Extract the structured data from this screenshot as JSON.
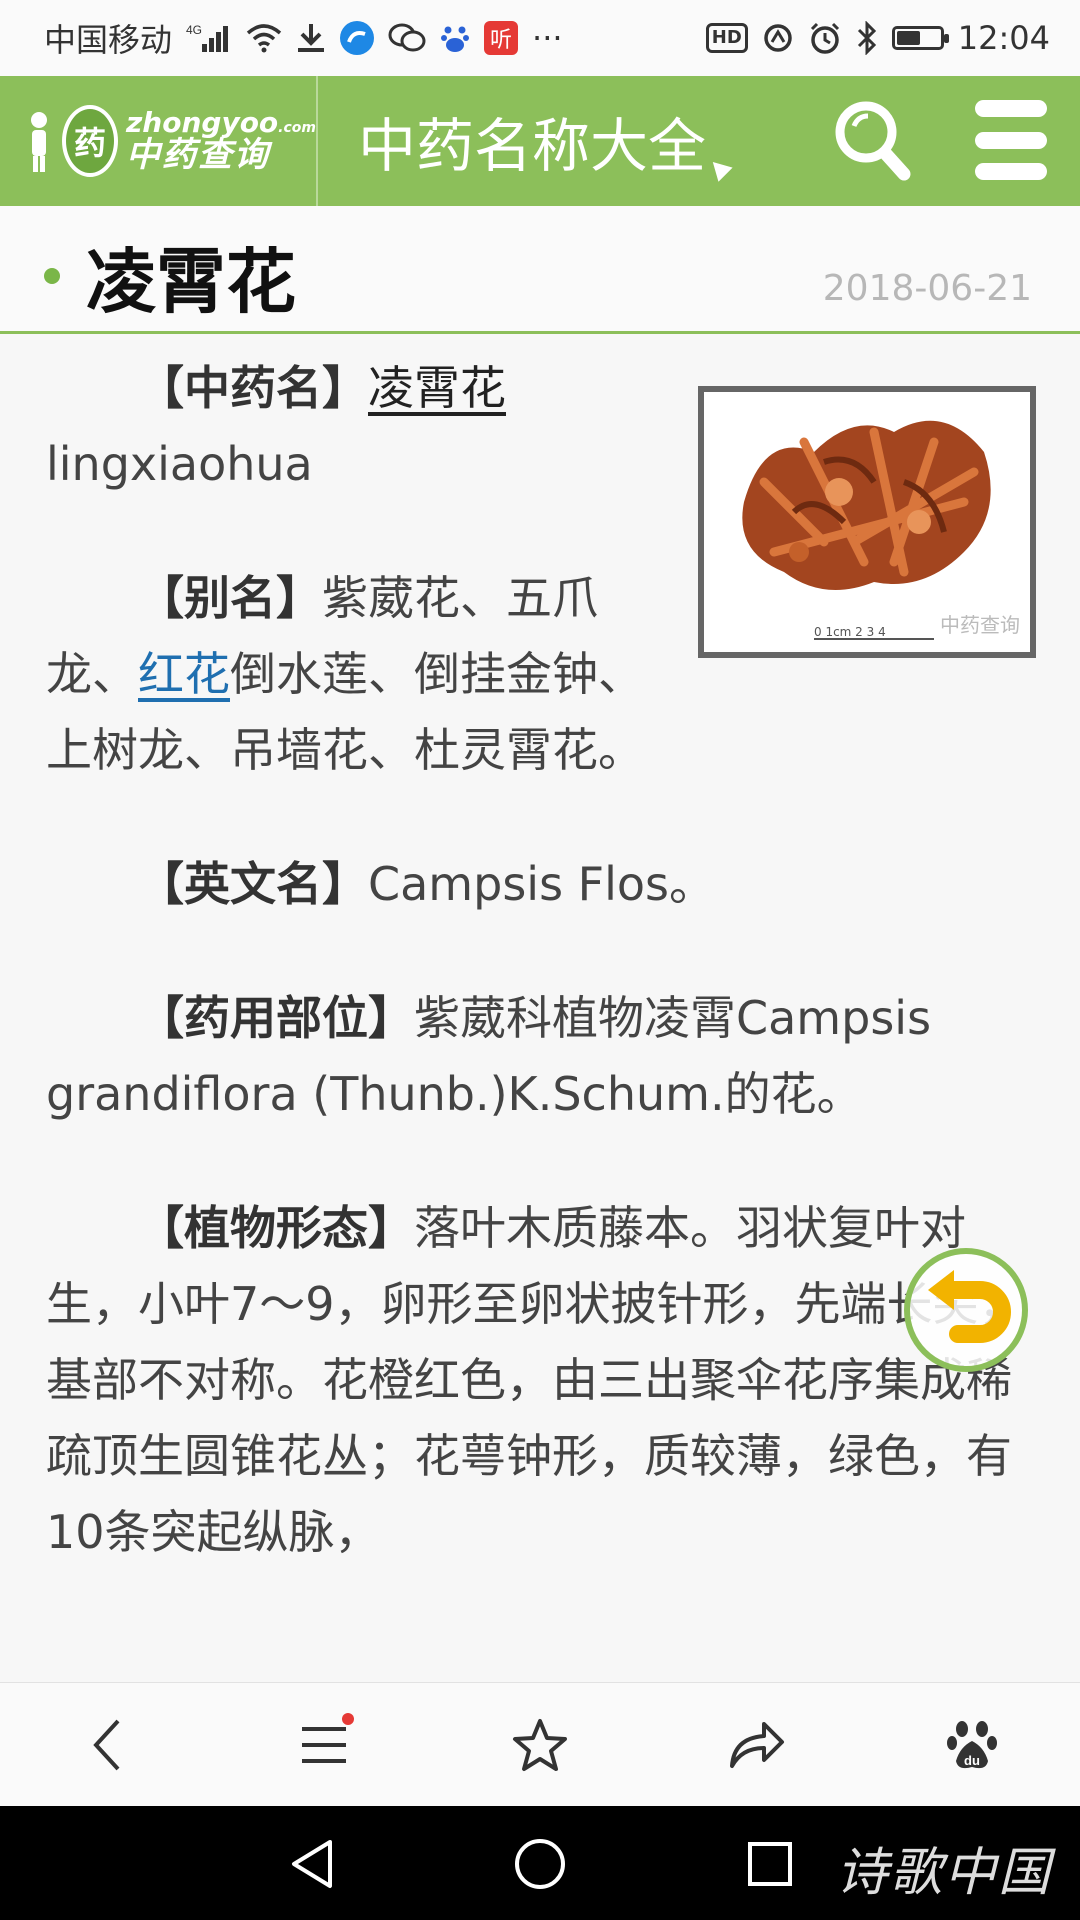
{
  "status_bar": {
    "carrier": "中国移动",
    "network": "4G",
    "notification_icons": [
      "signal-icon",
      "wifi-icon",
      "download-icon",
      "browser-app-icon",
      "wechat-icon",
      "baidu-icon",
      "ting-app-icon",
      "more-icon"
    ],
    "ting_label": "听",
    "more": "···",
    "hd": "HD",
    "time": "12:04",
    "battery_level": 0.55
  },
  "header": {
    "logo_top": "zhongyoo",
    "logo_domain": ".com",
    "logo_circle": "药",
    "logo_bottom": "中药查询",
    "site_title": "中药名称大全",
    "colors": {
      "brand_green": "#8cbf5a"
    }
  },
  "article": {
    "title": "凌霄花",
    "date": "2018-06-21",
    "image_watermark": "中药查询",
    "image_ruler": "0 1cm 2 3 4",
    "sections": {
      "name_label": "【中药名】",
      "name_link": "凌霄花",
      "pinyin": "lingxiaohua",
      "alias_label": "【别名】",
      "alias_text_1": "紫葳花、五爪龙、",
      "alias_link": "红花",
      "alias_text_2": "倒水莲、倒挂金钟、上树龙、吊墙花、杜灵霄花。",
      "english_label": "【英文名】",
      "english_text": "Campsis Flos。",
      "part_label": "【药用部位】",
      "part_text": "紫葳科植物凌霄Campsis grandiflora (Thunb.)K.Schum.的花。",
      "morph_label": "【植物形态】",
      "morph_text": "落叶木质藤本。羽状复叶对生，小叶7～9，卵形至卵状披针形，先端长尖，基部不对称。花橙红色，由三出聚伞花序集成稀疏顶生圆锥花丛；花萼钟形，质较薄，绿色，有10条突起纵脉，"
    }
  },
  "watermark": "诗歌中国"
}
